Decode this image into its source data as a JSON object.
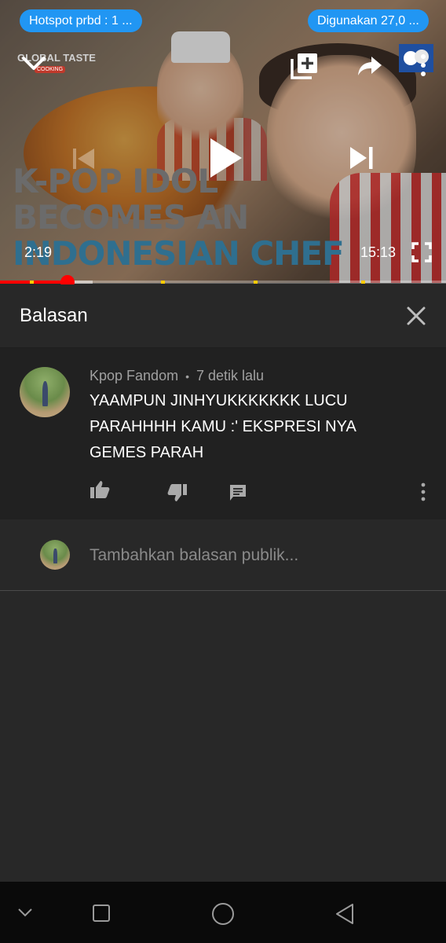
{
  "status_bar": {
    "left_pill": "Hotspot prbd : 1 ...",
    "right_pill": "Digunakan 27,0 ..."
  },
  "video": {
    "thumbnail_text": [
      "K-POP IDOL",
      "BECOMES AN",
      "INDONESIAN CHEF"
    ],
    "channel_brand": "GLOBAL TASTE",
    "channel_brand_sub": "COOKING",
    "current_time": "2:19",
    "total_time": "15:13",
    "progress_fraction": 0.153,
    "buffer_fraction": 0.207,
    "icons": [
      "chevron-down-icon",
      "add-to-playlist-icon",
      "share-icon",
      "more-vert-icon",
      "previous-icon",
      "play-icon",
      "next-icon",
      "fullscreen-icon"
    ],
    "accent_color": "#ff0000",
    "ad_marker_color": "#ffcc00"
  },
  "replies_panel": {
    "title": "Balasan",
    "close_icon": "close-icon"
  },
  "comment": {
    "author": "Kpop Fandom",
    "separator": "•",
    "time": "7 detik lalu",
    "text": "YAAMPUN JINHYUKKKKKKK LUCU PARAHHHH KAMU :' EKSPRESI NYA GEMES PARAH",
    "actions": [
      "like-icon",
      "dislike-icon",
      "reply-icon",
      "more-vert-icon"
    ]
  },
  "reply_input": {
    "placeholder": "Tambahkan balasan publik..."
  },
  "navbar": {
    "icons": [
      "chevron-down-icon",
      "recents-icon",
      "home-icon",
      "back-icon"
    ]
  },
  "colors": {
    "background": "#282828",
    "comment_background": "#212121",
    "pill": "#2196f3",
    "secondary_text": "#a0a0a0"
  }
}
